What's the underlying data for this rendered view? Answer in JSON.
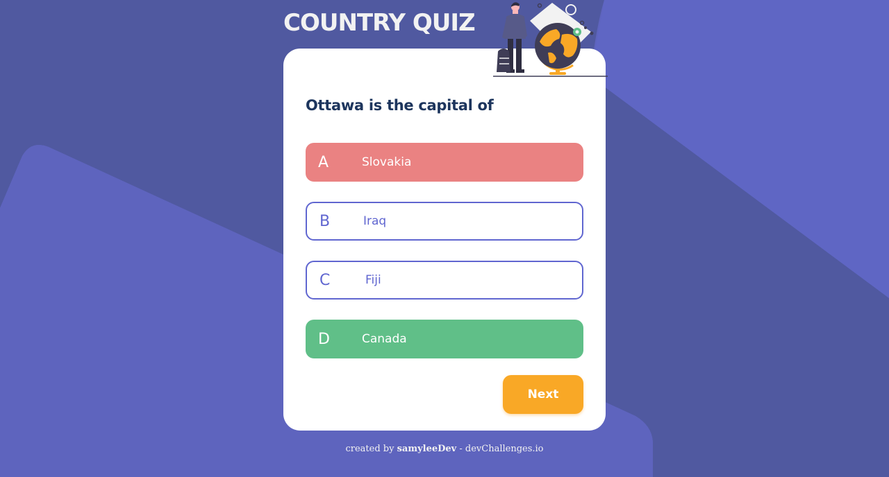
{
  "header": {
    "title": "COUNTRY QUIZ"
  },
  "question": {
    "text": "Ottawa is the capital of"
  },
  "options": [
    {
      "letter": "A",
      "label": "Slovakia",
      "state": "wrong"
    },
    {
      "letter": "B",
      "label": "Iraq",
      "state": "neutral"
    },
    {
      "letter": "C",
      "label": "Fiji",
      "state": "neutral"
    },
    {
      "letter": "D",
      "label": "Canada",
      "state": "correct"
    }
  ],
  "actions": {
    "next_label": "Next"
  },
  "footer": {
    "prefix": "created by",
    "author": "samyleeDev",
    "suffix": "- devChallenges.io"
  },
  "colors": {
    "accent": "#6066D0",
    "wrong": "#EA8282",
    "correct": "#60BF88",
    "next": "#F9A826",
    "question": "#1D355D"
  },
  "icons": {
    "illustration": "traveler-with-globe-illustration"
  }
}
